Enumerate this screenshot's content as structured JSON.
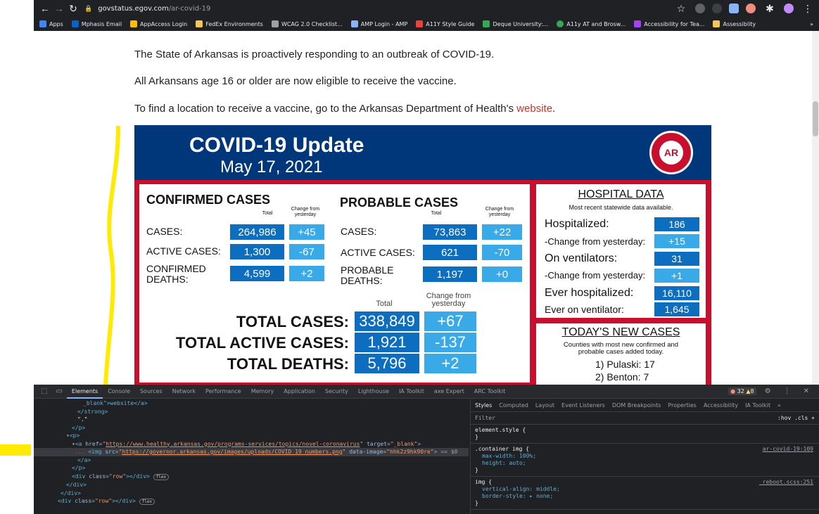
{
  "browser": {
    "url_host": "govstatus.egov.com",
    "url_path": "/ar-covid-19",
    "bookmarks": [
      "Apps",
      "Mphasis Email",
      "AppAccess Login",
      "FedEx Environments",
      "WCAG 2.0 Checklist...",
      "AMP Login - AMP",
      "A11Y Style Guide",
      "Deque University:...",
      "A11y AT and Brosw...",
      "Accessibility for Tea...",
      "Assessiblity"
    ]
  },
  "page": {
    "para1": "The State of Arkansas is proactively responding to an outbreak of COVID-19.",
    "para2": "All Arkansans age 16 or older are now eligible to receive the vaccine.",
    "para3_pre": "To find a location to receive a vaccine, go to the Arkansas Department of Health's ",
    "para3_link": "website",
    "para3_post": "."
  },
  "graphic": {
    "title": "COVID-19 Update",
    "date": "May 17, 2021",
    "seal_text": "AR",
    "confirmed": {
      "heading": "CONFIRMED CASES",
      "sub_total": "Total",
      "sub_change": "Change from yesterday",
      "rows": [
        {
          "label": "CASES:",
          "total": "264,986",
          "change": "+45"
        },
        {
          "label": "ACTIVE CASES:",
          "total": "1,300",
          "change": "-67"
        },
        {
          "label": "CONFIRMED DEATHS:",
          "total": "4,599",
          "change": "+2"
        }
      ]
    },
    "probable": {
      "heading": "PROBABLE CASES",
      "sub_total": "Total",
      "sub_change": "Change from yesterday",
      "rows": [
        {
          "label": "CASES:",
          "total": "73,863",
          "change": "+22"
        },
        {
          "label": "ACTIVE CASES:",
          "total": "621",
          "change": "-70"
        },
        {
          "label": "PROBABLE DEATHS:",
          "total": "1,197",
          "change": "+0"
        }
      ]
    },
    "totals": {
      "sub_total": "Total",
      "sub_change": "Change from yesterday",
      "rows": [
        {
          "label": "TOTAL CASES:",
          "total": "338,849",
          "change": "+67"
        },
        {
          "label": "TOTAL ACTIVE CASES:",
          "total": "1,921",
          "change": "-137"
        },
        {
          "label": "TOTAL DEATHS:",
          "total": "5,796",
          "change": "+2"
        }
      ]
    },
    "hospital": {
      "title": "HOSPITAL DATA",
      "subtitle": "Most recent statewide data available.",
      "rows": [
        {
          "label": "Hospitalized:",
          "value": "186"
        },
        {
          "label": "-Change from yesterday:",
          "value": "+15"
        },
        {
          "label": "On ventilators:",
          "value": "31"
        },
        {
          "label": "-Change from yesterday:",
          "value": "+1"
        },
        {
          "label": "Ever hospitalized:",
          "value": "16,110"
        },
        {
          "label": "Ever on ventilator:",
          "value": "1,645"
        }
      ]
    },
    "new_cases": {
      "title": "TODAY'S NEW CASES",
      "subtitle": "Counties with most new confirmed and probable cases added today.",
      "items": [
        "1) Pulaski: 17",
        "2) Benton: 7"
      ]
    }
  },
  "devtools": {
    "tabs": [
      "Elements",
      "Console",
      "Sources",
      "Network",
      "Performance",
      "Memory",
      "Application",
      "Security",
      "Lighthouse",
      "IA Toolkit",
      "axe Expert",
      "ARC Toolkit"
    ],
    "errors": "32",
    "warnings": "8",
    "dom": {
      "l1": "_blank\">website</a>",
      "l2": "</strong>",
      "l3": "\".\"",
      "l4": "</p>",
      "l5": "<p>",
      "href": "https://www.healthy.arkansas.gov/programs-services/topics/novel-coronavirus",
      "target": "_blank",
      "img_src": "https://governor.arkansas.gov/images/uploads/COVID_19_numbers.png",
      "img_data": "hhk2z9hk90re",
      "eq": "== $0",
      "l8": "</a>",
      "l9": "</p>",
      "l10_class": "row",
      "flex": "flex",
      "l11": "</div>",
      "l12": "</div>",
      "l13_class": "row"
    },
    "styles_tabs": [
      "Styles",
      "Computed",
      "Layout",
      "Event Listeners",
      "DOM Breakpoints",
      "Properties",
      "Accessibility",
      "IA Toolkit"
    ],
    "filter_placeholder": "Filter",
    "filter_tools": ":hov  .cls  +",
    "rules": [
      {
        "selector": "element.style {",
        "props": [],
        "source": ""
      },
      {
        "selector": ".container img {",
        "props": [
          "max-width: 100%;",
          "height: auto;"
        ],
        "source": "ar-covid-19:109"
      },
      {
        "selector": "img {",
        "props": [
          "vertical-align: middle;",
          "border-style: ▸ none;"
        ],
        "source": "_reboot.scss:251"
      }
    ]
  }
}
